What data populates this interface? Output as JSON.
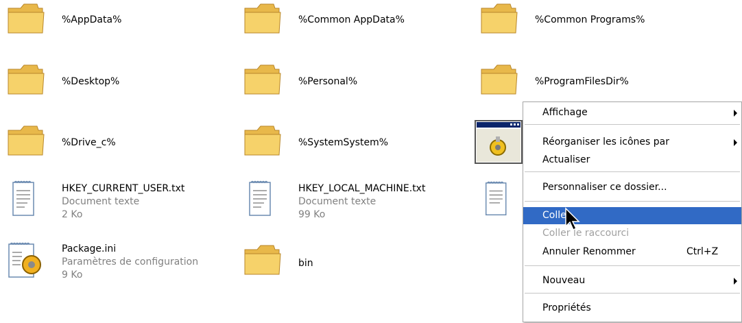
{
  "items": [
    {
      "name": "%AppData%",
      "type": "folder"
    },
    {
      "name": "%Common AppData%",
      "type": "folder"
    },
    {
      "name": "%Common Programs%",
      "type": "folder"
    },
    {
      "name": "%Desktop%",
      "type": "folder"
    },
    {
      "name": "%Personal%",
      "type": "folder"
    },
    {
      "name": "%ProgramFilesDir%",
      "type": "folder"
    },
    {
      "name": "%Drive_c%",
      "type": "folder"
    },
    {
      "name": "%SystemSystem%",
      "type": "folder"
    },
    {
      "name": "HKEY_CURRENT_USER.txt",
      "desc": "Document texte",
      "size": "2 Ko",
      "type": "textfile"
    },
    {
      "name": "HKEY_LOCAL_MACHINE.txt",
      "desc": "Document texte",
      "size": "99 Ko",
      "type": "textfile"
    },
    {
      "name": "Package.ini",
      "desc": "Paramètres de configuration",
      "size": "9 Ko",
      "type": "inifile"
    },
    {
      "name": "bin",
      "type": "folder"
    }
  ],
  "context_menu": {
    "items": [
      {
        "label": "Affichage",
        "submenu": true
      },
      {
        "label": "Réorganiser les icônes par",
        "submenu": true
      },
      {
        "label": "Actualiser"
      },
      {
        "label": "Personnaliser ce dossier..."
      },
      {
        "label": "Coller",
        "highlighted": true
      },
      {
        "label": "Coller le raccourci",
        "disabled": true
      },
      {
        "label": "Annuler Renommer",
        "shortcut": "Ctrl+Z"
      },
      {
        "label": "Nouveau",
        "submenu": true
      },
      {
        "label": "Propriétés"
      }
    ]
  },
  "colors": {
    "highlight": "#316ac5",
    "folder": "#f6d26a",
    "disabled_text": "#a0a0a0",
    "subtext": "#808080"
  }
}
